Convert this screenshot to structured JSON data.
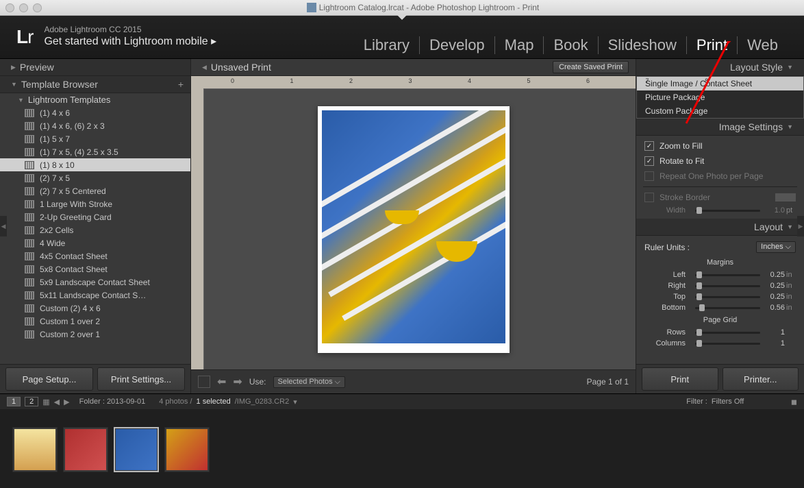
{
  "titlebar": "Lightroom Catalog.lrcat - Adobe Photoshop Lightroom - Print",
  "header": {
    "version": "Adobe Lightroom CC 2015",
    "tagline": "Get started with Lightroom mobile"
  },
  "modules": [
    "Library",
    "Develop",
    "Map",
    "Book",
    "Slideshow",
    "Print",
    "Web"
  ],
  "activeModule": "Print",
  "leftPanel": {
    "preview": "Preview",
    "templateBrowser": "Template Browser",
    "templateGroup": "Lightroom Templates",
    "templates": [
      "(1) 4 x 6",
      "(1) 4 x 6, (6) 2 x 3",
      "(1) 5 x 7",
      "(1) 7 x 5, (4) 2.5 x 3.5",
      "(1) 8 x 10",
      "(2) 7 x 5",
      "(2) 7 x 5 Centered",
      "1 Large With Stroke",
      "2-Up Greeting Card",
      "2x2 Cells",
      "4 Wide",
      "4x5 Contact Sheet",
      "5x8 Contact Sheet",
      "5x9 Landscape Contact Sheet",
      "5x11 Landscape Contact S…",
      "Custom (2) 4 x 6",
      "Custom 1 over 2",
      "Custom 2 over 1"
    ],
    "selectedTemplate": "(1) 8 x 10",
    "pageSetup": "Page Setup...",
    "printSettings": "Print Settings..."
  },
  "center": {
    "title": "Unsaved Print",
    "createSaved": "Create Saved Print",
    "useLabel": "Use:",
    "useValue": "Selected Photos",
    "pageStatus": "Page 1 of 1"
  },
  "rightPanel": {
    "layoutStyle": {
      "title": "Layout Style",
      "options": [
        "Single Image / Contact Sheet",
        "Picture Package",
        "Custom Package"
      ],
      "selected": "Single Image / Contact Sheet"
    },
    "imageSettings": {
      "title": "Image Settings",
      "zoomToFill": {
        "label": "Zoom to Fill",
        "checked": true
      },
      "rotateToFit": {
        "label": "Rotate to Fit",
        "checked": true
      },
      "repeat": {
        "label": "Repeat One Photo per Page",
        "checked": false
      },
      "strokeBorder": {
        "label": "Stroke Border",
        "checked": false
      },
      "widthLabel": "Width",
      "widthValue": "1.0",
      "widthUnit": "pt"
    },
    "layout": {
      "title": "Layout",
      "rulerUnitsLabel": "Ruler Units :",
      "rulerUnitsValue": "Inches",
      "marginsTitle": "Margins",
      "margins": [
        {
          "label": "Left",
          "value": "0.25",
          "unit": "in"
        },
        {
          "label": "Right",
          "value": "0.25",
          "unit": "in"
        },
        {
          "label": "Top",
          "value": "0.25",
          "unit": "in"
        },
        {
          "label": "Bottom",
          "value": "0.56",
          "unit": "in"
        }
      ],
      "pageGridTitle": "Page Grid",
      "rowsLabel": "Rows",
      "rowsValue": "1",
      "columnsLabel": "Columns",
      "columnsValue": "1"
    },
    "printBtn": "Print",
    "printerBtn": "Printer..."
  },
  "filmstrip": {
    "folder": "Folder : 2013-09-01",
    "count": "4 photos /",
    "selected": "1 selected",
    "filename": "/IMG_0283.CR2",
    "filterLabel": "Filter :",
    "filterValue": "Filters Off"
  }
}
